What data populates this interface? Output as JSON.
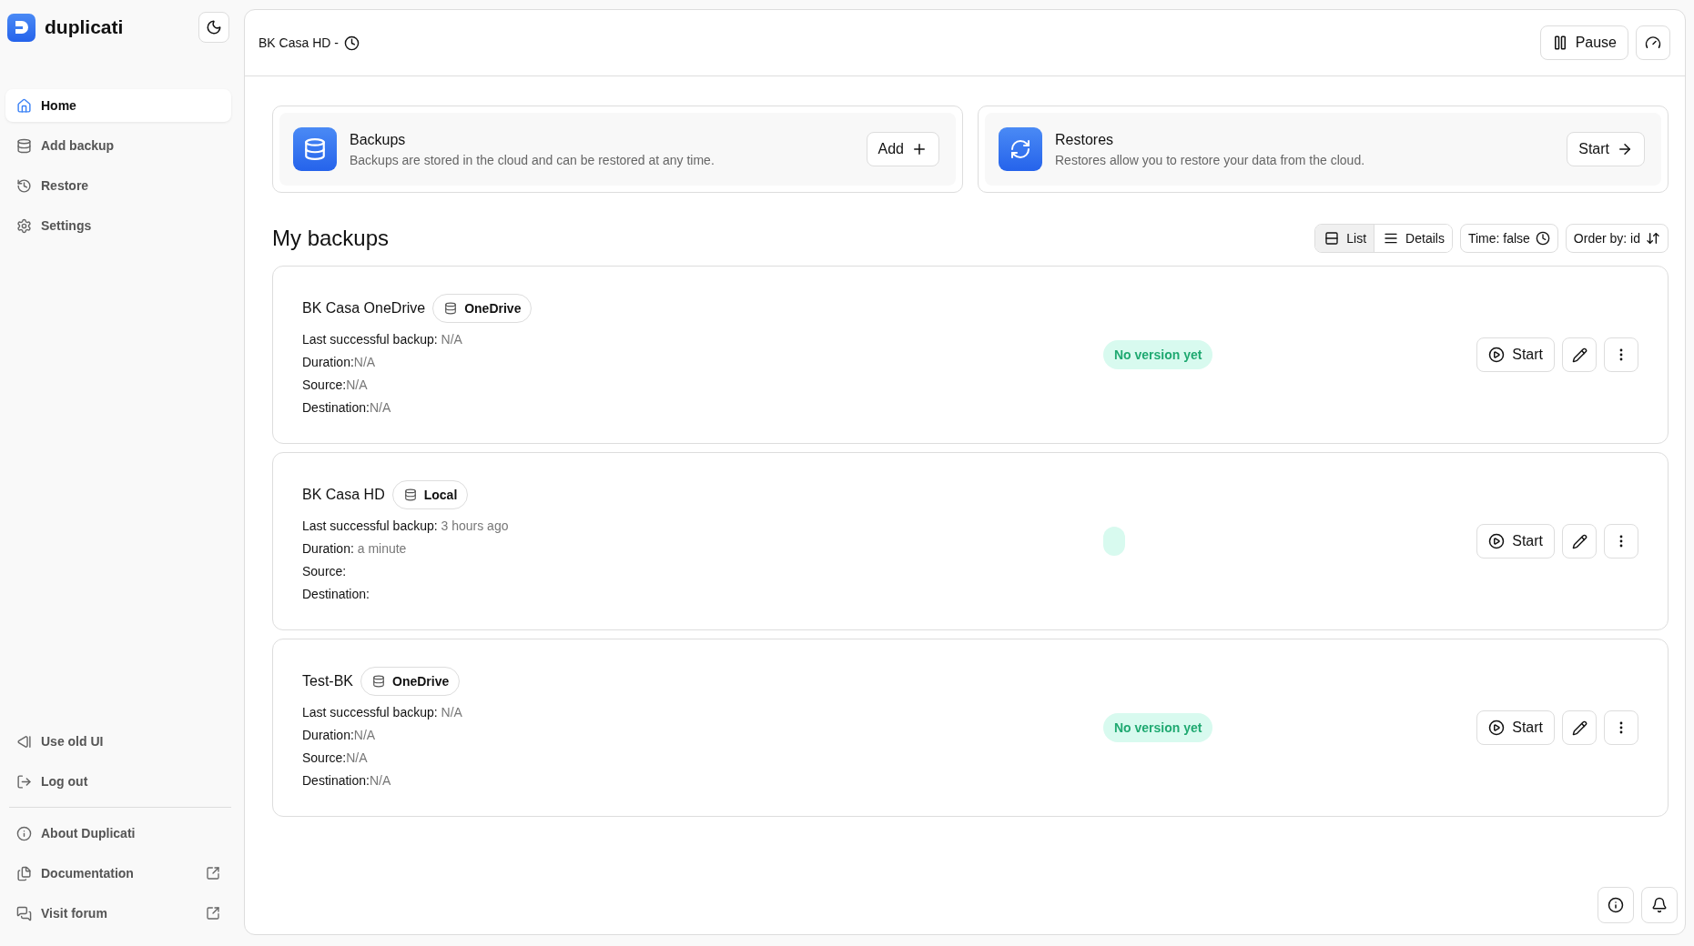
{
  "brand": {
    "name": "duplicati"
  },
  "sidebar": {
    "items": [
      {
        "label": "Home",
        "selected": true
      },
      {
        "label": "Add backup",
        "selected": false
      },
      {
        "label": "Restore",
        "selected": false
      },
      {
        "label": "Settings",
        "selected": false
      }
    ],
    "footer_items": [
      {
        "label": "Use old UI"
      },
      {
        "label": "Log out"
      }
    ],
    "help_items": [
      {
        "label": "About Duplicati",
        "external": false
      },
      {
        "label": "Documentation",
        "external": true
      },
      {
        "label": "Visit forum",
        "external": true
      }
    ]
  },
  "header": {
    "title": "BK Casa HD -",
    "pause_button": "Pause"
  },
  "overview": [
    {
      "kind": "backups",
      "title": "Backups",
      "description": "Backups are stored in the cloud and can be restored at any time.",
      "action": "Add"
    },
    {
      "kind": "restores",
      "title": "Restores",
      "description": "Restores allow you to restore your data from the cloud.",
      "action": "Start"
    }
  ],
  "my_backups": {
    "title": "My backups",
    "view_modes": [
      {
        "label": "List",
        "selected": true
      },
      {
        "label": "Details",
        "selected": false
      }
    ],
    "time_toggle": "Time: false",
    "order_by": "Order by: id",
    "items": [
      {
        "name": "BK Casa OneDrive",
        "destination_type": "OneDrive",
        "status_shown": true,
        "status": "No version yet",
        "start_button": "Start",
        "details": [
          {
            "label": "Last successful backup: ",
            "value": "N/A"
          },
          {
            "label": "Duration:",
            "value": "N/A"
          },
          {
            "label": "Source:",
            "value": "N/A"
          },
          {
            "label": "Destination:",
            "value": "N/A"
          }
        ]
      },
      {
        "name": "BK Casa HD",
        "destination_type": "Local",
        "status_shown": true,
        "start_button": "Start",
        "details": [
          {
            "label": "Last successful backup: ",
            "value": "3 hours ago"
          },
          {
            "label": "Duration: ",
            "value": "a minute"
          },
          {
            "label": "Source:"
          },
          {
            "label": "Destination:"
          }
        ]
      },
      {
        "name": "Test-BK",
        "destination_type": "OneDrive",
        "status_shown": true,
        "status": "No version yet",
        "start_button": "Start",
        "details": [
          {
            "label": "Last successful backup: ",
            "value": "N/A"
          },
          {
            "label": "Duration:",
            "value": "N/A"
          },
          {
            "label": "Source:",
            "value": "N/A"
          },
          {
            "label": "Destination:",
            "value": "N/A"
          }
        ]
      }
    ]
  }
}
